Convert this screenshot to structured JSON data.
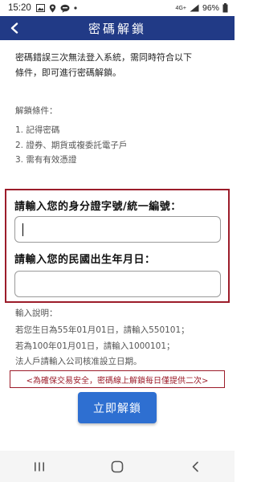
{
  "status_bar": {
    "time": "15:20",
    "network": "4G+",
    "battery": "96%",
    "left_icons": [
      "image-icon",
      "location-icon",
      "line-icon",
      "dot-icon"
    ]
  },
  "app_bar": {
    "title": "密碼解鎖"
  },
  "intro": {
    "line1": "密碼錯誤三次無法登入系統，需同時符合以下",
    "line2": "條件，即可進行密碼解鎖。"
  },
  "conditions": {
    "heading": "解鎖條件：",
    "items": [
      "1. 記得密碼",
      "2. 證券、期貨或複委託電子戶",
      "3. 需有有效憑證"
    ]
  },
  "form": {
    "id_label": "請輸入您的身分證字號/統一編號：",
    "id_value": "",
    "birth_label": "請輸入您的民國出生年月日：",
    "birth_value": ""
  },
  "notes": {
    "heading": "輸入說明：",
    "items": [
      "若您生日為55年01月01日，請輸入550101；",
      "若為100年01月01日，請輸入1000101；",
      "法人戶請輸入公司核准設立日期。"
    ]
  },
  "warning": "<為確保交易安全，密碼線上解鎖每日僅提供二次>",
  "button": {
    "label": "立即解鎖"
  },
  "colors": {
    "header": "#213a86",
    "border_red": "#9c1c2a",
    "button_blue": "#2e6fd1"
  }
}
